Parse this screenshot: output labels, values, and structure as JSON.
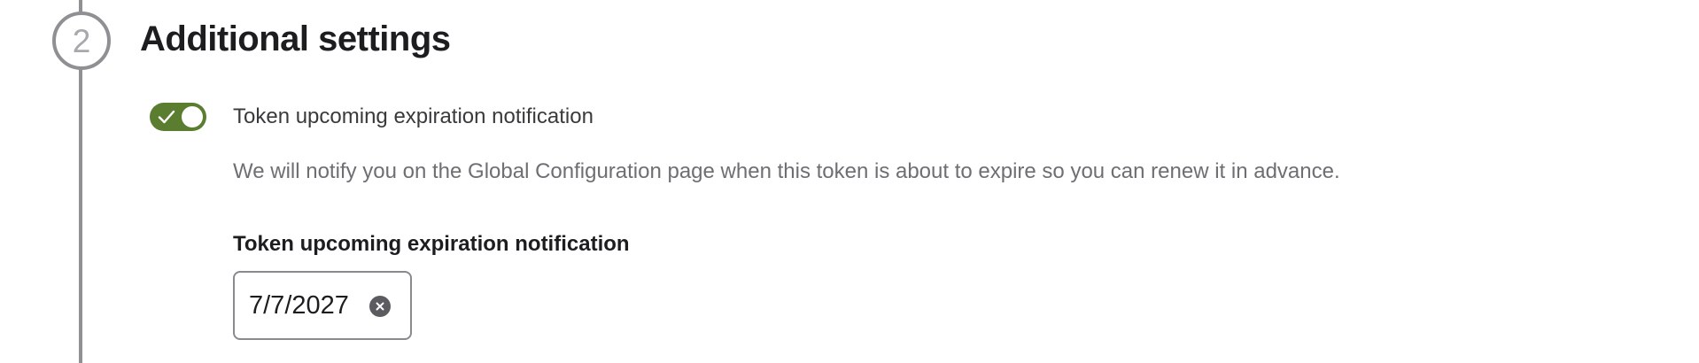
{
  "stepper": {
    "step_number": "2"
  },
  "section": {
    "title": "Additional settings"
  },
  "notification_toggle": {
    "label": "Token upcoming expiration notification",
    "checked": true,
    "color": "#5a7d2f"
  },
  "help_text": "We will notify you on the Global Configuration page when this token is about to expire so you can renew it in advance.",
  "expiration_field": {
    "label": "Token upcoming expiration notification",
    "value": "7/7/2027",
    "clear_icon": "close-circle-icon"
  }
}
